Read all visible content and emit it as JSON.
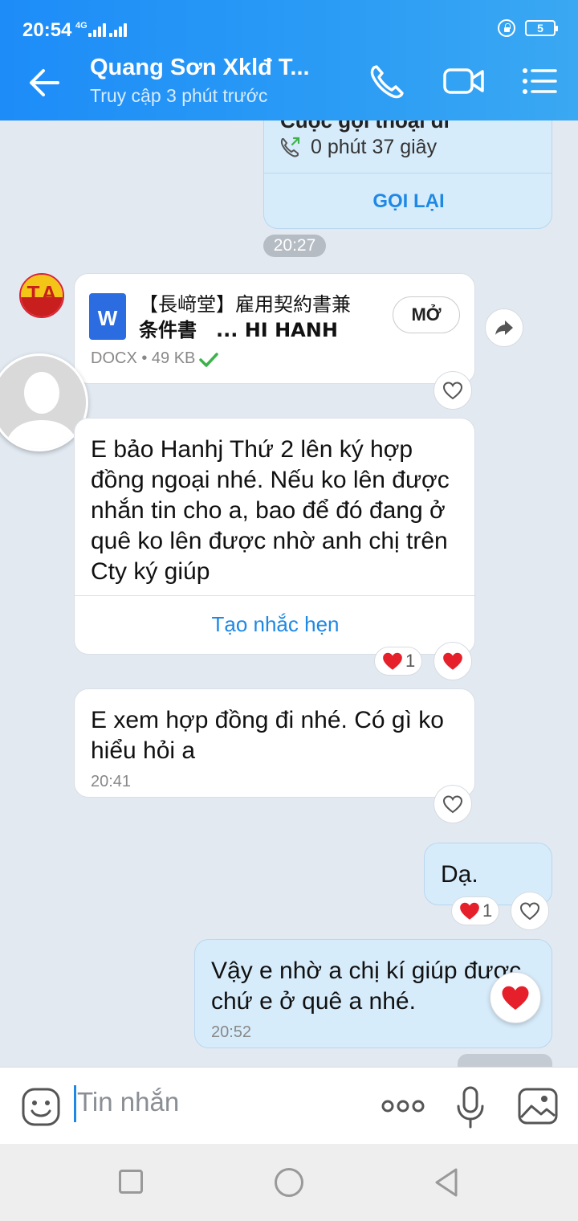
{
  "status_bar": {
    "time": "20:54",
    "network": "4G",
    "battery": "5"
  },
  "header": {
    "title": "Quang Sơn Xklđ T...",
    "subtitle": "Truy cập 3 phút trước"
  },
  "call_card": {
    "title": "Cuộc gọi thoại đi",
    "duration": "0 phút 37 giây",
    "callback": "GỌI LẠI"
  },
  "time_pill": "20:27",
  "sender_avatar_text": "TA",
  "file_message": {
    "icon_letter": "W",
    "name_line1": "【長﨑堂】雇用契約書兼",
    "name_line2": "条件書　... HI HANH",
    "meta": "DOCX • 49 KB",
    "open": "MỞ"
  },
  "messages": [
    {
      "text": "E bảo Hanhj Thứ 2 lên ký hợp đồng ngoại nhé. Nếu ko lên được nhắn tin cho a, bao để đó đang ở quê ko lên được nhờ anh chị trên Cty ký giúp",
      "action": "Tạo nhắc hẹn",
      "reaction_count": "1"
    },
    {
      "text": "E xem hợp đồng đi nhé. Có gì ko hiểu hỏi a",
      "time": "20:41"
    },
    {
      "text": "Dạ.",
      "reaction_count": "1"
    },
    {
      "text": "Vậy e nhờ a chị kí giúp được chứ e ở quê a nhé.",
      "time": "20:52"
    }
  ],
  "composer": {
    "placeholder": "Tin nhắn"
  },
  "colors": {
    "header": "#1d8cf8",
    "accent": "#1e88e5",
    "heart": "#e5202a",
    "check": "#3cb34a"
  }
}
